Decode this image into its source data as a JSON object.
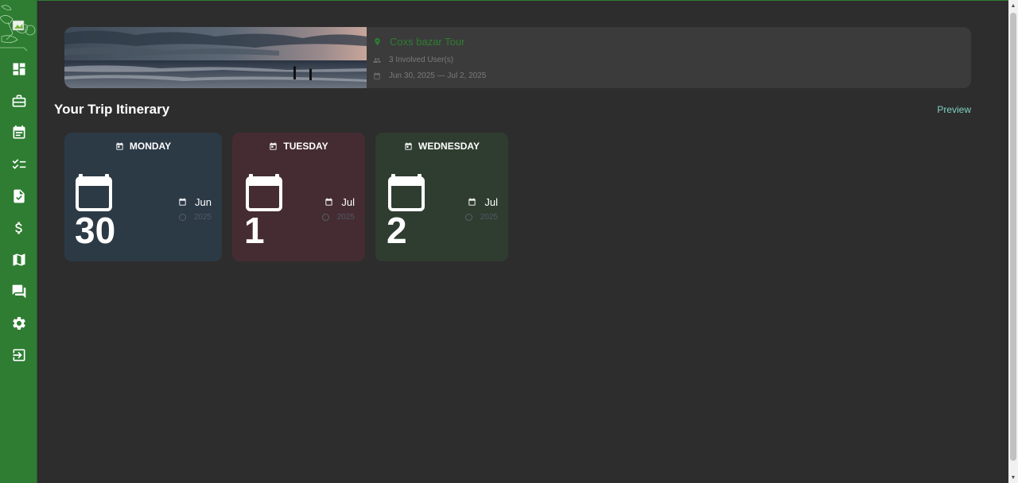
{
  "sidebar": {
    "items": [
      {
        "name": "dashboard-icon"
      },
      {
        "name": "briefcase-icon"
      },
      {
        "name": "calendar-icon"
      },
      {
        "name": "checklist-icon"
      },
      {
        "name": "document-check-icon"
      },
      {
        "name": "dollar-icon"
      },
      {
        "name": "map-icon"
      },
      {
        "name": "chat-icon"
      },
      {
        "name": "gear-icon"
      },
      {
        "name": "logout-icon"
      }
    ]
  },
  "trip": {
    "title": "Coxs bazar Tour",
    "users": "3 Involved User(s)",
    "dates": "Jun 30, 2025 — Jul 2, 2025"
  },
  "itinerary": {
    "title": "Your Trip Itinerary",
    "preview_label": "Preview",
    "days": [
      {
        "weekday": "MONDAY",
        "day": "30",
        "month": "Jun",
        "year": "2025",
        "color": "#2c3a46"
      },
      {
        "weekday": "TUESDAY",
        "day": "1",
        "month": "Jul",
        "year": "2025",
        "color": "#452c33"
      },
      {
        "weekday": "WEDNESDAY",
        "day": "2",
        "month": "Jul",
        "year": "2025",
        "color": "#2f3d30"
      }
    ]
  },
  "colors": {
    "sidebar": "#2e7d32",
    "background": "#2d2d2d",
    "accent_link": "#7fd1c1"
  }
}
